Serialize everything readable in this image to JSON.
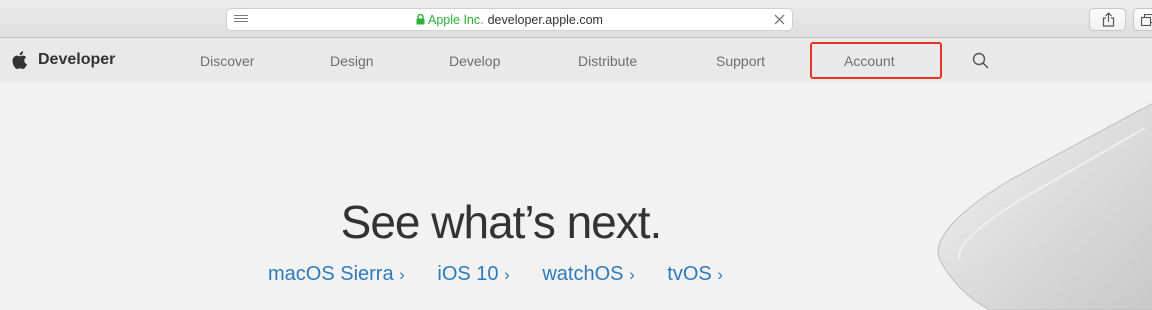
{
  "browser": {
    "organization": "Apple Inc.",
    "domain": "developer.apple.com"
  },
  "nav": {
    "brand": "Developer",
    "items": [
      "Discover",
      "Design",
      "Develop",
      "Distribute",
      "Support",
      "Account"
    ]
  },
  "hero": {
    "title": "See what’s next.",
    "links": [
      "macOS Sierra",
      "iOS 10",
      "watchOS",
      "tvOS"
    ]
  },
  "colors": {
    "link": "#2d7bbd",
    "secure": "#2cb237",
    "highlight": "#e53422"
  },
  "icons": {
    "reader": "reader-icon",
    "lock": "lock-icon",
    "clear": "close-icon",
    "share": "share-icon",
    "tabs": "tabs-icon",
    "logo": "apple-logo-icon",
    "search": "search-icon",
    "chevron": "chevron-right-icon"
  }
}
